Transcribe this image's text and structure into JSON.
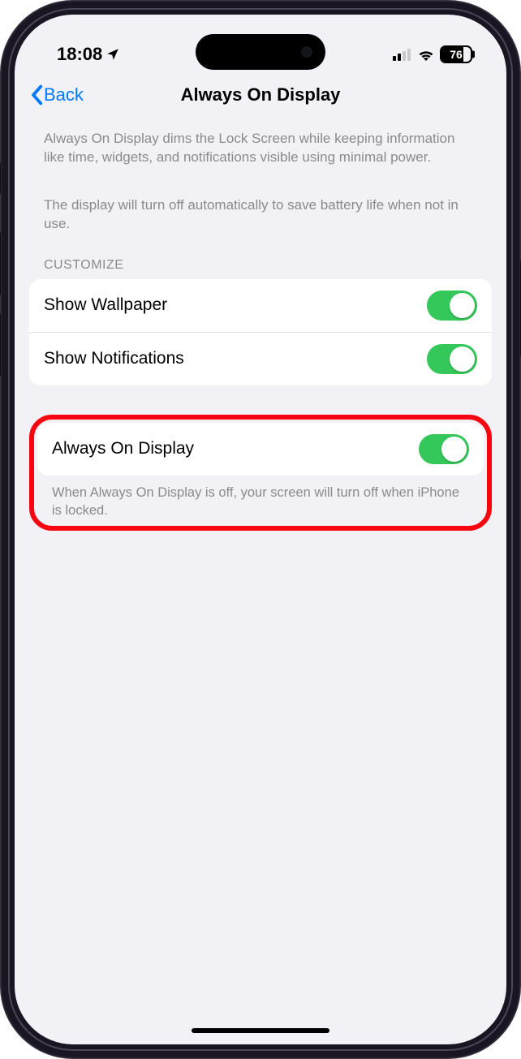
{
  "status": {
    "time": "18:08",
    "battery": "76",
    "cellBars": 2,
    "cellTotal": 4
  },
  "nav": {
    "back_label": "Back",
    "title": "Always On Display"
  },
  "descriptions": {
    "p1": "Always On Display dims the Lock Screen while keeping information like time, widgets, and notifications visible using minimal power.",
    "p2": "The display will turn off automatically to save battery life when not in use."
  },
  "customize": {
    "header": "CUSTOMIZE",
    "rows": [
      {
        "label": "Show Wallpaper",
        "on": true
      },
      {
        "label": "Show Notifications",
        "on": true
      }
    ]
  },
  "aod": {
    "label": "Always On Display",
    "on": true,
    "note": "When Always On Display is off, your screen will turn off when iPhone is locked."
  }
}
